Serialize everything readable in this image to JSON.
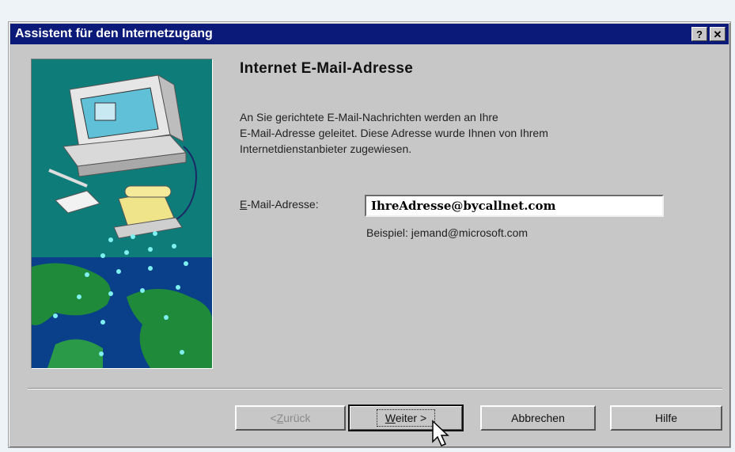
{
  "window": {
    "title": "Assistent für den Internetzugang",
    "help_button": "?",
    "close_button": "✕"
  },
  "page": {
    "heading": "Internet E-Mail-Adresse",
    "description_lines": [
      "An Sie gerichtete E-Mail-Nachrichten werden an Ihre",
      "E-Mail-Adresse geleitet. Diese Adresse wurde Ihnen von Ihrem",
      "Internetdienstanbieter zugewiesen."
    ],
    "email_label_accel": "E",
    "email_label_rest": "-Mail-Adresse:",
    "email_value": "IhreAdresse@bycallnet.com",
    "example_text": "Beispiel: jemand@microsoft.com"
  },
  "buttons": {
    "back_prefix": "< ",
    "back_accel": "Z",
    "back_rest": "urück",
    "next_accel": "W",
    "next_rest": "eiter >",
    "cancel": "Abbrechen",
    "help": "Hilfe"
  },
  "colors": {
    "titlebar": "#0b1a78",
    "dialog_bg": "#c7c7c7",
    "illustration_bg": "#0e7d7a"
  }
}
